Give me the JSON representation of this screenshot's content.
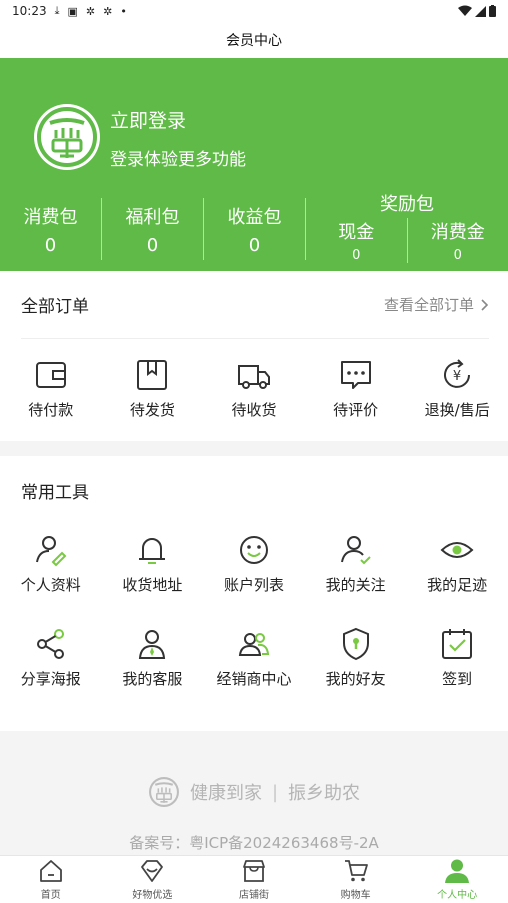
{
  "status_bar": {
    "time": "10:23",
    "indicators": [
      "download-icon",
      "a-icon",
      "bug-icon",
      "bug-icon",
      "dot"
    ]
  },
  "navbar": {
    "title": "会员中心"
  },
  "header": {
    "login_title": "立即登录",
    "login_subtitle": "登录体验更多功能",
    "stats": [
      {
        "label": "消费包",
        "value": "0"
      },
      {
        "label": "福利包",
        "value": "0"
      },
      {
        "label": "收益包",
        "value": "0"
      }
    ],
    "reward": {
      "title": "奖励包",
      "items": [
        {
          "label": "现金",
          "value": "0"
        },
        {
          "label": "消费金",
          "value": "0"
        }
      ]
    }
  },
  "orders": {
    "title": "全部订单",
    "view_all": "查看全部订单",
    "items": [
      {
        "label": "待付款",
        "icon": "wallet-icon"
      },
      {
        "label": "待发货",
        "icon": "package-icon"
      },
      {
        "label": "待收货",
        "icon": "truck-icon"
      },
      {
        "label": "待评价",
        "icon": "comment-icon"
      },
      {
        "label": "退换/售后",
        "icon": "refund-icon"
      }
    ]
  },
  "tools": {
    "title": "常用工具",
    "row1": [
      {
        "label": "个人资料",
        "icon": "profile-edit-icon"
      },
      {
        "label": "收货地址",
        "icon": "bell-icon"
      },
      {
        "label": "账户列表",
        "icon": "smile-icon"
      },
      {
        "label": "我的关注",
        "icon": "user-check-icon"
      },
      {
        "label": "我的足迹",
        "icon": "eye-icon"
      }
    ],
    "row2": [
      {
        "label": "分享海报",
        "icon": "share-icon"
      },
      {
        "label": "我的客服",
        "icon": "service-icon"
      },
      {
        "label": "经销商中心",
        "icon": "dealer-icon"
      },
      {
        "label": "我的好友",
        "icon": "shield-icon"
      },
      {
        "label": "签到",
        "icon": "calendar-check-icon"
      }
    ]
  },
  "footer": {
    "slogan_left": "健康到家",
    "separator": "|",
    "slogan_right": "振乡助农",
    "icp": "备案号：粤ICP备2024263468号-2A"
  },
  "tabbar": {
    "tabs": [
      {
        "label": "首页",
        "icon": "home-icon",
        "active": false
      },
      {
        "label": "好物优选",
        "icon": "diamond-icon",
        "active": false
      },
      {
        "label": "店铺街",
        "icon": "store-icon",
        "active": false
      },
      {
        "label": "购物车",
        "icon": "cart-icon",
        "active": false
      },
      {
        "label": "个人中心",
        "icon": "user-icon",
        "active": true
      }
    ]
  },
  "colors": {
    "brand_green": "#5fba47",
    "icon_dark": "#333333",
    "accent_green": "#7ac943"
  }
}
